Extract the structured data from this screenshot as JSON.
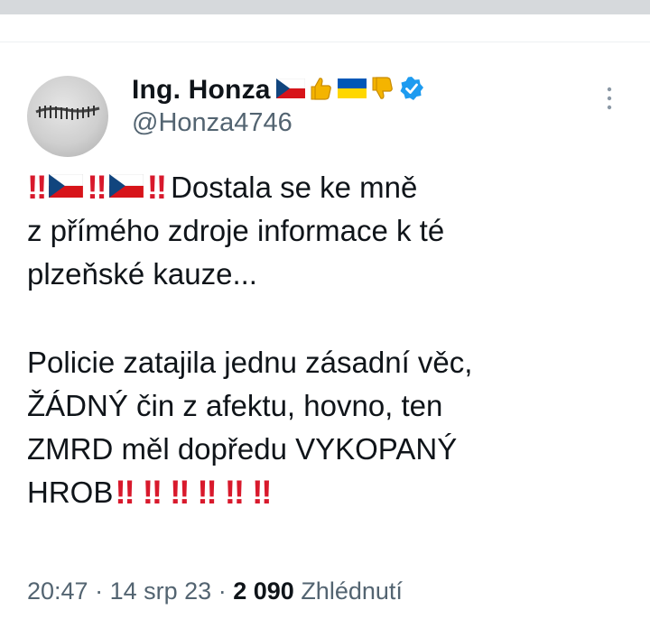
{
  "author": {
    "display_name": "Ing. Honza",
    "handle": "@Honza4746",
    "name_emoji": [
      "czech-flag",
      "thumbs-up",
      "ukraine-flag",
      "thumbs-down",
      "verified-badge"
    ]
  },
  "tweet": {
    "line1_text": "Dostala se ke mně",
    "line2_text": "z přímého zdroje informace k té",
    "line3_text": "plzeňské kauze...",
    "line4_text": "Policie zatajila jednu zásadní věc,",
    "line5_text": "ŽÁDNÝ čin z afektu, hovno, ten",
    "line6_text": "ZMRD měl dopředu VYKOPANÝ",
    "line7_text": "HROB",
    "bang": "‼",
    "colors": {
      "bang": "#d8192c",
      "text": "#0f1419",
      "muted": "#536471",
      "verified": "#1d9bf0"
    }
  },
  "meta": {
    "time": "20:47",
    "sep1": "·",
    "date": "14 srp 23",
    "sep2": "·",
    "views": "2 090",
    "views_label": "Zhlédnutí"
  }
}
